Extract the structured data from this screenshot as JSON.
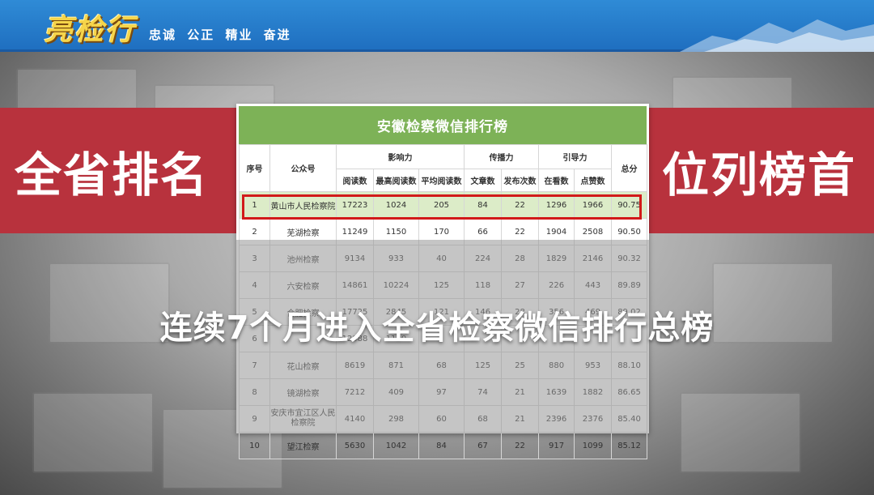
{
  "header": {
    "logo_text": "亮检行",
    "slogan": "忠诚 公正 精业 奋进",
    "brand_color": "#1f6fc0",
    "logo_color": "#f6d54a"
  },
  "banners": {
    "left": "全省排名",
    "right": "位列榜首",
    "color": "#b8323d"
  },
  "caption": "连续7个月进入全省检察微信排行总榜",
  "ranking_table": {
    "title": "安徽检察微信排行榜",
    "header_color": "#7db257",
    "highlight_color": "#d21a1a",
    "group_headers": {
      "rank": "序号",
      "account": "公众号",
      "influence": "影响力",
      "spread": "传播力",
      "guidance": "引导力",
      "total": "总分"
    },
    "sub_headers": [
      "阅读数",
      "最高阅读数",
      "平均阅读数",
      "文章数",
      "发布次数",
      "在看数",
      "点赞数"
    ],
    "rows": [
      [
        "1",
        "黄山市人民检察院",
        "17223",
        "1024",
        "205",
        "84",
        "22",
        "1296",
        "1966",
        "90.75"
      ],
      [
        "2",
        "芜湖检察",
        "11249",
        "1150",
        "170",
        "66",
        "22",
        "1904",
        "2508",
        "90.50"
      ],
      [
        "3",
        "池州检察",
        "9134",
        "933",
        "40",
        "224",
        "28",
        "1829",
        "2146",
        "90.32"
      ],
      [
        "4",
        "六安检察",
        "14861",
        "10224",
        "125",
        "118",
        "27",
        "226",
        "443",
        "89.89"
      ],
      [
        "5",
        "合肥检察",
        "17725",
        "2845",
        "121",
        "146",
        "28",
        "356",
        "469",
        "89.02"
      ],
      [
        "6",
        "",
        "12988",
        "1120",
        "",
        "",
        "",
        "",
        "",
        ""
      ],
      [
        "7",
        "花山检察",
        "8619",
        "871",
        "68",
        "125",
        "25",
        "880",
        "953",
        "88.10"
      ],
      [
        "8",
        "镜湖检察",
        "7212",
        "409",
        "97",
        "74",
        "21",
        "1639",
        "1882",
        "86.65"
      ],
      [
        "9",
        "安庆市宜江区人民检察院",
        "4140",
        "298",
        "60",
        "68",
        "21",
        "2396",
        "2376",
        "85.40"
      ],
      [
        "10",
        "望江检察",
        "5630",
        "1042",
        "84",
        "67",
        "22",
        "917",
        "1099",
        "85.12"
      ]
    ]
  }
}
